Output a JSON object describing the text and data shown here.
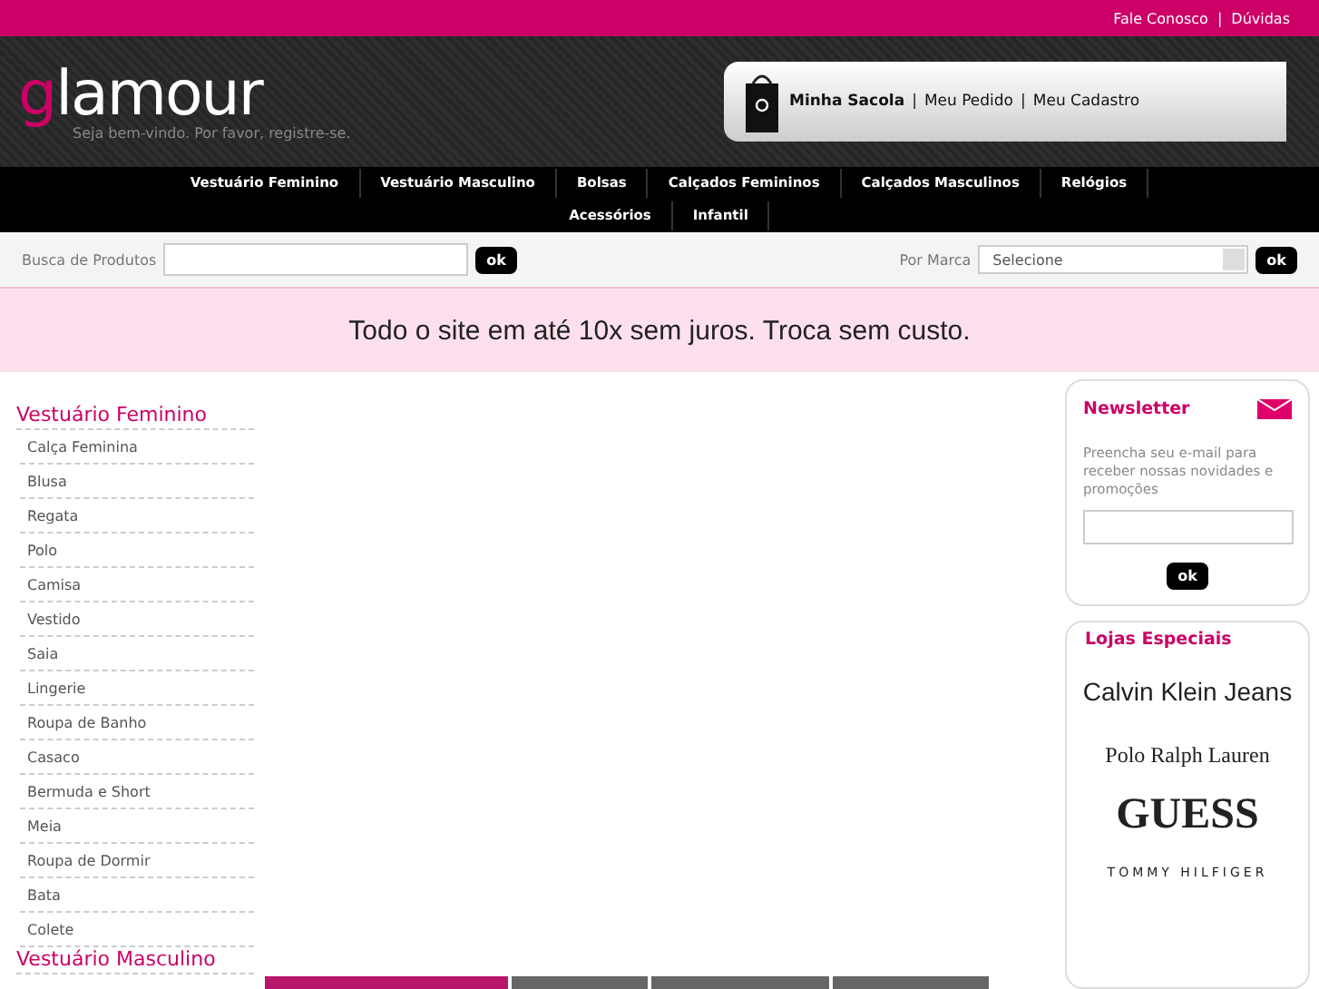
{
  "separator": "|",
  "top_links": [
    "Fale Conosco",
    "Dúvidas"
  ],
  "header": {
    "logo": "glamour",
    "welcome": "Seja bem-vindo. Por favor, registre-se.",
    "account_links": [
      "Minha Sacola",
      "Meu Pedido",
      "Meu Cadastro"
    ]
  },
  "nav": [
    "Vestuário Feminino",
    "Vestuário Masculino",
    "Bolsas",
    "Calçados Femininos",
    "Calçados Masculinos",
    "Relógios",
    "Acessórios",
    "Infantil"
  ],
  "search": {
    "label": "Busca de Produtos",
    "button": "ok",
    "brand_label": "Por Marca",
    "brand_value": "Selecione",
    "brand_button": "ok"
  },
  "banner": "Todo o site em até 10x sem juros. Troca sem custo.",
  "sidebar": [
    {
      "title": "Vestuário Feminino",
      "items": [
        "Calça Feminina",
        "Blusa",
        "Regata",
        "Polo",
        "Camisa",
        "Vestido",
        "Saia",
        "Lingerie",
        "Roupa de Banho",
        "Casaco",
        "Bermuda e Short",
        "Meia",
        "Roupa de Dormir",
        "Bata",
        "Colete"
      ]
    },
    {
      "title": "Vestuário Masculino"
    }
  ],
  "newsletter": {
    "title": "Newsletter",
    "text": "Preencha seu e-mail para receber nossas novidades e promoções",
    "button": "ok"
  },
  "stores": {
    "title": "Lojas Especiais",
    "brands": [
      "Calvin Klein Jeans",
      "Polo Ralph Lauren",
      "GUESS",
      "TOMMY HILFIGER"
    ]
  },
  "bottom_tabs": [
    {
      "selected": true
    },
    {
      "selected": false
    },
    {
      "selected": false
    },
    {
      "selected": false
    }
  ]
}
